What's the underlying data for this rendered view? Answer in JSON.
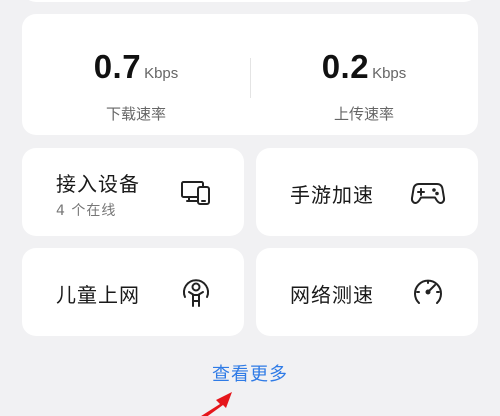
{
  "speed": {
    "download": {
      "value": "0.7",
      "unit": "Kbps",
      "label": "下载速率"
    },
    "upload": {
      "value": "0.2",
      "unit": "Kbps",
      "label": "上传速率"
    }
  },
  "tiles": [
    {
      "title": "接入设备",
      "subtitle": "4 个在线",
      "icon": "devices-icon"
    },
    {
      "title": "手游加速",
      "icon": "gamepad-icon"
    },
    {
      "title": "儿童上网",
      "icon": "child-icon"
    },
    {
      "title": "网络测速",
      "icon": "speedometer-icon"
    }
  ],
  "more_link": "查看更多",
  "colors": {
    "accent": "#2f7be6",
    "annotation_arrow": "#e5161b"
  }
}
